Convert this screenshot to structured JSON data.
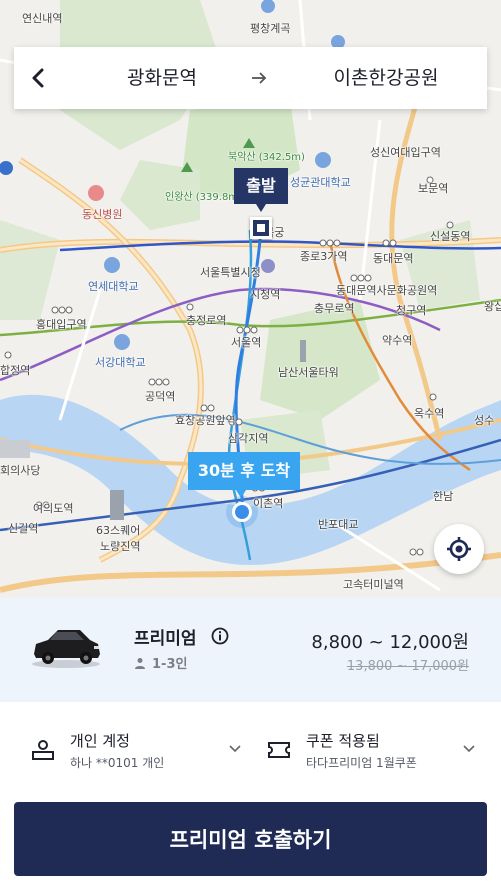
{
  "route": {
    "origin": "광화문역",
    "destination": "이촌한강공원",
    "back_icon": "chevron-left-icon",
    "arrow_icon": "arrow-right-icon"
  },
  "map": {
    "start_label": "출발",
    "arrival_label": "30분 후 도착",
    "places": [
      "연신내역",
      "평창계곡",
      "북악산 (342.5m)",
      "성신여대입구역",
      "인왕산 (339.8m)",
      "성균관대학교",
      "보문역",
      "동신병원",
      "경복궁",
      "신설동역",
      "종로3가역",
      "동대문역",
      "서울특별시청",
      "연세대학교",
      "시청역",
      "동대문역사문화공원역",
      "청구역",
      "왕십",
      "충정로역",
      "충무로역",
      "홍대입구역",
      "서울역",
      "약수역",
      "서강대학교",
      "남산서울타워",
      "합정역",
      "공덕역",
      "효창공원앞역",
      "옥수역",
      "삼각지역",
      "성수",
      "회의사당",
      "여의도역",
      "한남",
      "이촌역",
      "반포대교",
      "신길역",
      "63스퀘어",
      "노량진역",
      "고속터미널역"
    ],
    "locate_icon": "crosshair-icon"
  },
  "vehicle": {
    "name": "프리미엄",
    "info_icon": "info-icon",
    "seats": "1-3인",
    "price": "8,800 ~ 12,000원",
    "original_price": "13,800 ~ 17,000원"
  },
  "options": {
    "account_title": "개인 계정",
    "account_sub": "하나 **0101 개인",
    "coupon_title": "쿠폰 적용됨",
    "coupon_sub": "타다프리미엄 1월쿠폰"
  },
  "call_button": "프리미엄 호출하기",
  "colors": {
    "primary": "#1f2a55",
    "arrival": "#39a4ef",
    "start": "#243566",
    "panel_bg": "#eef4fb"
  }
}
